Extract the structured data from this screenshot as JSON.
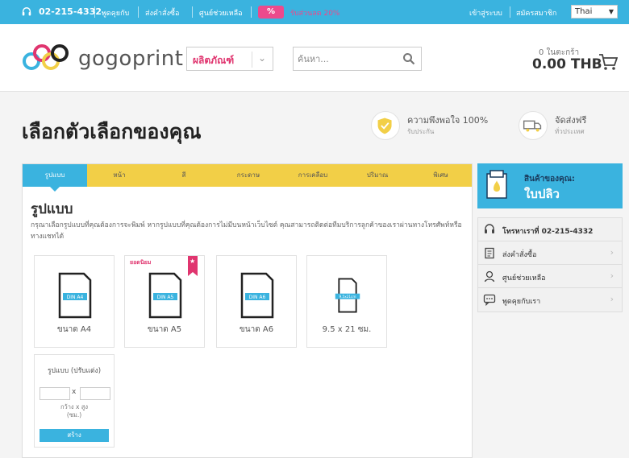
{
  "topbar": {
    "phone": "02-215-4332",
    "links": [
      "พูดคุยกับ",
      "ส่งคำสั่งซื้อ",
      "ศูนย์ช่วยเหลือ"
    ],
    "promo_badge": "%",
    "promo_text": "รับส่วนลด 20%",
    "login": "เข้าสู่ระบบ",
    "register": "สมัครสมาชิก",
    "language": "Thai"
  },
  "header": {
    "logo_text": "gogoprint",
    "category_label": "ผลิตภัณฑ์",
    "search_placeholder": "ค้นหา...",
    "cart_count": "0 ในตะกร้า",
    "cart_total": "0.00 THB"
  },
  "hero": {
    "title": "เลือกตัวเลือกของคุณ",
    "features": [
      {
        "title": "ความพึงพอใจ 100%",
        "subtitle": "รับประกัน",
        "icon": "shield-check-icon"
      },
      {
        "title": "จัดส่งฟรี",
        "subtitle": "ทั่วประเทศ",
        "icon": "truck-icon"
      }
    ]
  },
  "tabs": [
    "รูปแบบ",
    "หน้า",
    "สี",
    "กระดาษ",
    "การเคลือบ",
    "ปริมาณ",
    "พิเศษ"
  ],
  "active_tab": 0,
  "section": {
    "title": "รูปแบบ",
    "description": "กรุณาเลือกรูปแบบที่คุณต้องการจะพิมพ์ หากรูปแบบที่คุณต้องการไม่มีบนหน้าเว็บไซต์ คุณสามารถติดต่อทีมบริการลูกค้าของเราผ่านทางโทรศัพท์หรือทางแชทได้"
  },
  "formats": [
    {
      "tag": "DIN A4",
      "label": "ขนาด A4",
      "popular": ""
    },
    {
      "tag": "DIN A5",
      "label": "ขนาด A5",
      "popular": "ยอดนิยม"
    },
    {
      "tag": "DIN A6",
      "label": "ขนาด A6",
      "popular": ""
    },
    {
      "tag": "9.5x21cm",
      "label": "9.5 x 21 ซม.",
      "popular": ""
    }
  ],
  "custom": {
    "title": "รูปแบบ (ปรับแต่ง)",
    "x": "x",
    "dims": "กว้าง x สูง",
    "unit": "(ซม.)",
    "button": "สร้าง"
  },
  "sidebar": {
    "head_label": "สินค้าของคุณ:",
    "head_product": "ใบปลิว",
    "items": [
      {
        "label": "โทรหาเราที่ 02-215-4332",
        "icon": "headset-icon"
      },
      {
        "label": "ส่งคำสั่งซื้อ",
        "icon": "clipboard-icon"
      },
      {
        "label": "ศูนย์ช่วยเหลือ",
        "icon": "support-agent-icon"
      },
      {
        "label": "พูดคุยกับเรา",
        "icon": "chat-icon"
      }
    ]
  },
  "colors": {
    "brand_blue": "#3ab3df",
    "tab_yellow": "#f2cf47",
    "accent_pink": "#e0356f"
  }
}
